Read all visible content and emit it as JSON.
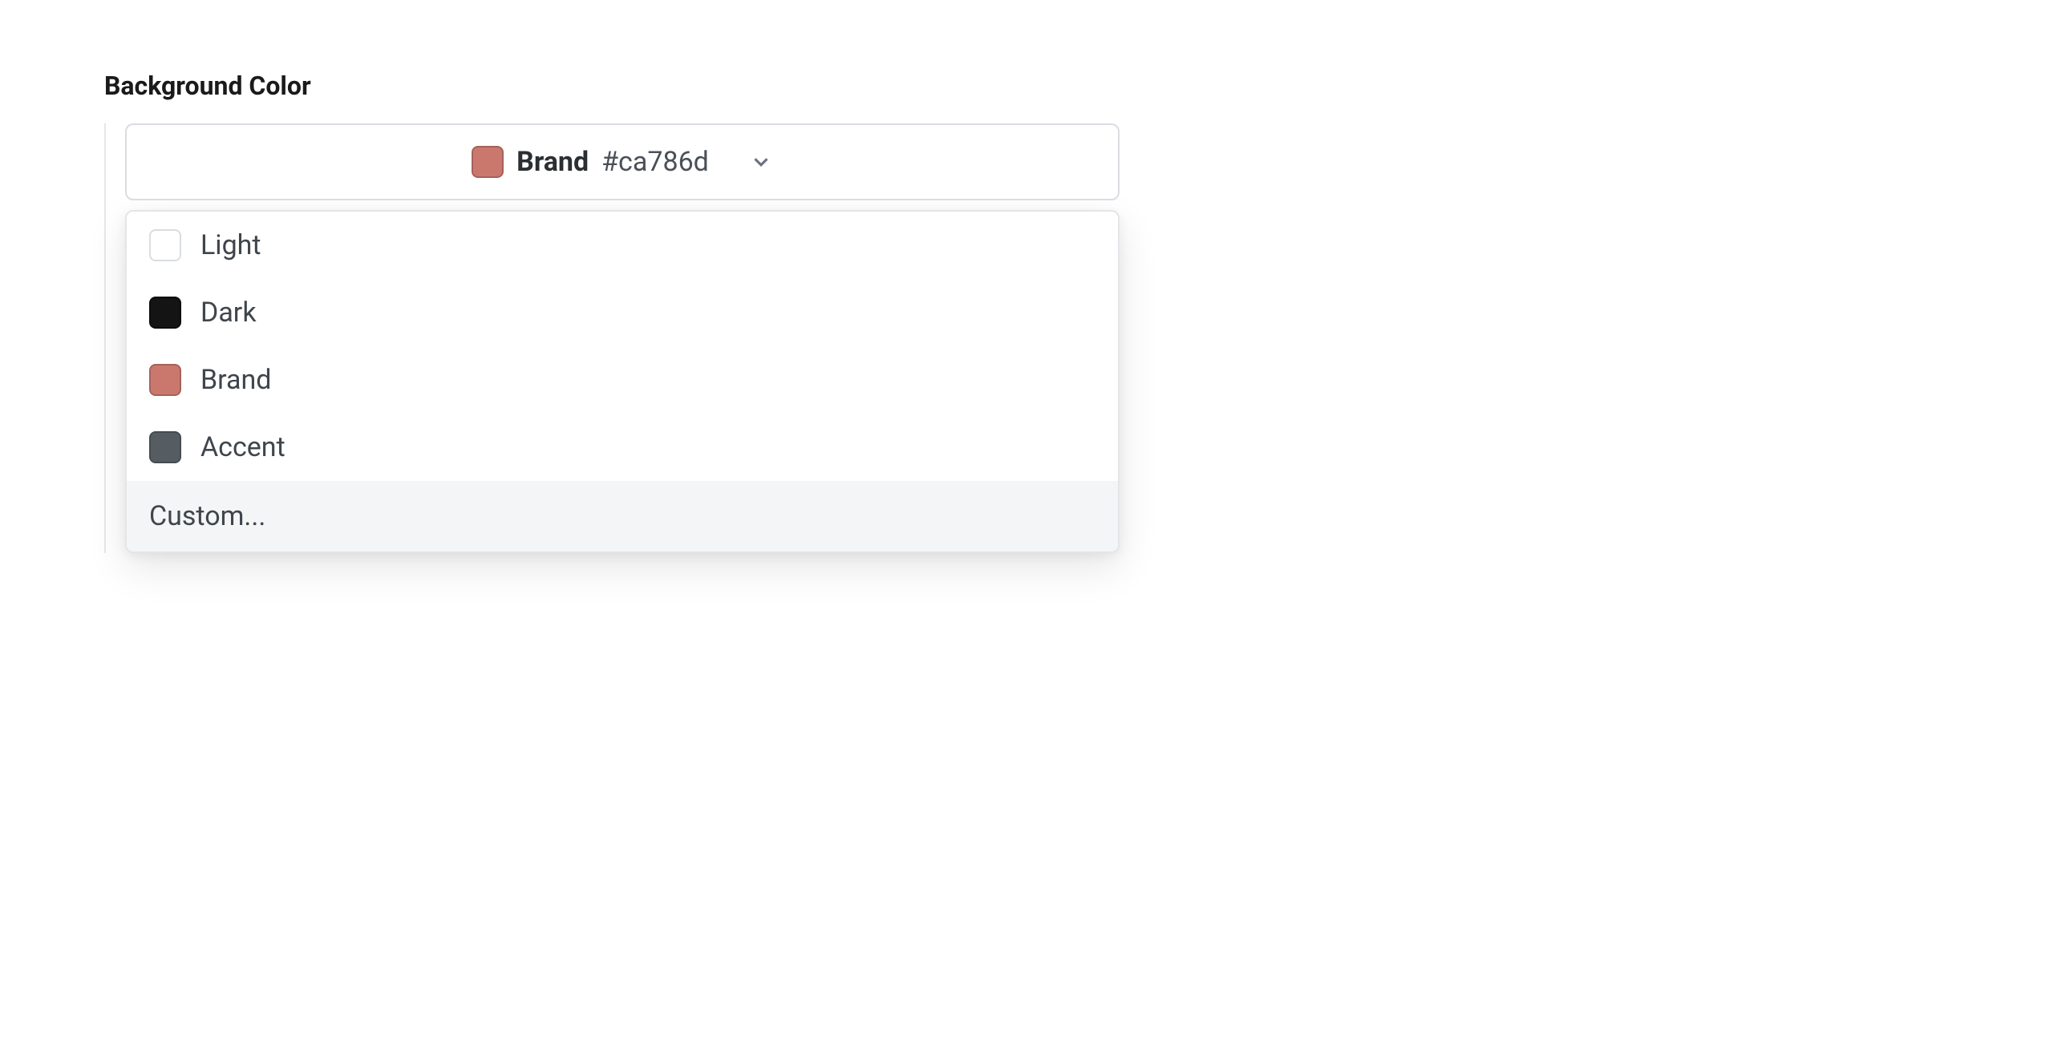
{
  "field": {
    "label": "Background Color"
  },
  "selected": {
    "name": "Brand",
    "hex": "#ca786d",
    "swatch": "#ca786d"
  },
  "options": [
    {
      "name": "Light",
      "swatch": "#ffffff"
    },
    {
      "name": "Dark",
      "swatch": "#141414"
    },
    {
      "name": "Brand",
      "swatch": "#ca786d"
    },
    {
      "name": "Accent",
      "swatch": "#555d62"
    }
  ],
  "custom_label": "Custom..."
}
